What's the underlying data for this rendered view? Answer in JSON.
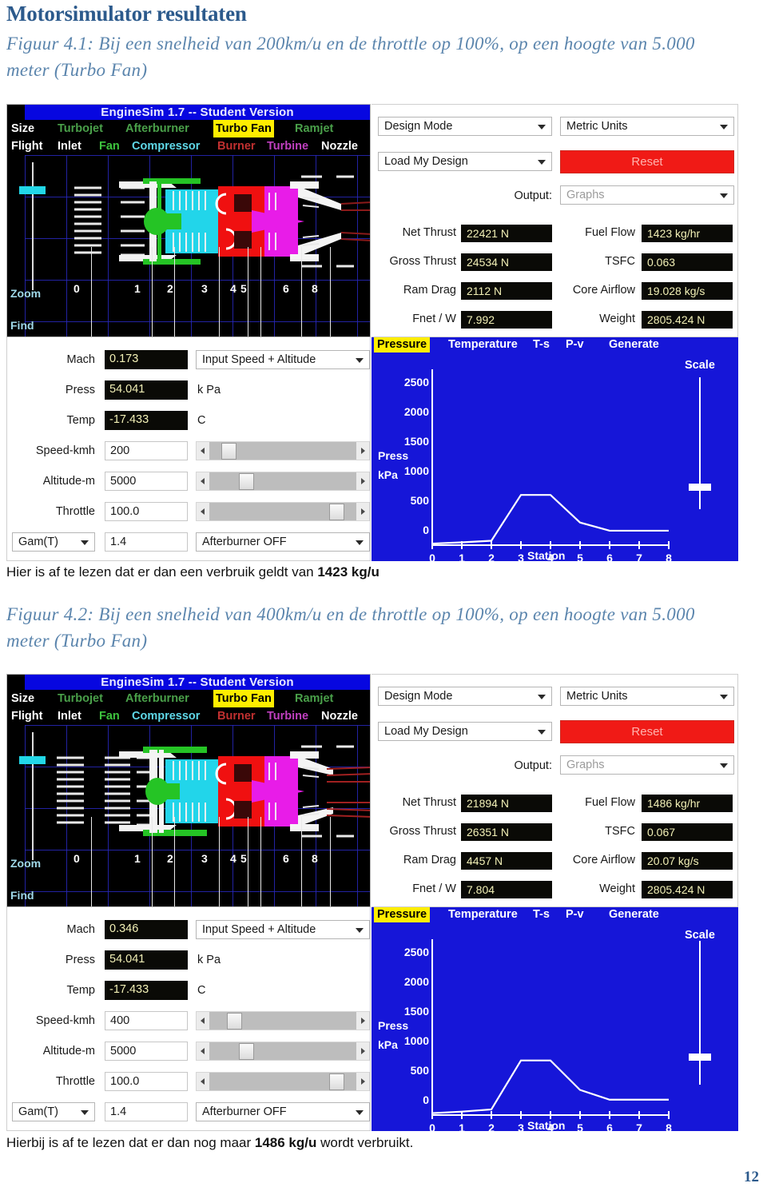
{
  "document": {
    "title": "Motorsimulator resultaten",
    "page_number": "12",
    "figure1_caption": "Figuur 4.1: Bij een snelheid van 200km/u en de throttle op 100%, op een hoogte van 5.000 meter (Turbo Fan)",
    "figure1_note_prefix": "Hier is af te lezen dat er dan een verbruik geldt van ",
    "figure1_note_value": "1423 kg/u",
    "figure1_note_suffix": "",
    "figure2_caption": "Figuur 4.2: Bij een snelheid van 400km/u en de throttle op 100%, op een hoogte van 5.000 meter (Turbo Fan)",
    "figure2_note_prefix": "Hierbij is af te lezen dat er dan nog maar ",
    "figure2_note_value": "1486 kg/u",
    "figure2_note_suffix": " wordt verbruikt."
  },
  "colors": {
    "heading": "#2c5a8c",
    "caption": "#5b85ad",
    "graph_background": "#1616d8",
    "title_bar": "#0707e0",
    "highlight": "#ffee00",
    "reset_button": "#f01a16",
    "readout_text": "#f2f0b6"
  },
  "sim": {
    "title_bar": "EngineSim 1.7  -- Student Version",
    "menu_row1": [
      {
        "label": "Size",
        "color": "#ffffff",
        "selected": false
      },
      {
        "label": "Turbojet",
        "color": "#4aa04a",
        "selected": false
      },
      {
        "label": "Afterburner",
        "color": "#4aa04a",
        "selected": false
      },
      {
        "label": "Turbo Fan",
        "color": "#000000",
        "selected": true
      },
      {
        "label": "Ramjet",
        "color": "#4aa04a",
        "selected": false
      }
    ],
    "menu_row2": [
      {
        "label": "Flight",
        "color": "#ffffff",
        "selected": false
      },
      {
        "label": "Inlet",
        "color": "#ffffff",
        "selected": false
      },
      {
        "label": "Fan",
        "color": "#3ec43e",
        "selected": false
      },
      {
        "label": "Compressor",
        "color": "#5fd8e8",
        "selected": false
      },
      {
        "label": "Burner",
        "color": "#c03030",
        "selected": false
      },
      {
        "label": "Turbine",
        "color": "#c040c0",
        "selected": false
      },
      {
        "label": "Nozzle",
        "color": "#ffffff",
        "selected": false
      }
    ],
    "side_labels": [
      "Zoom",
      "Find"
    ],
    "station_numbers": [
      "0",
      "1",
      "2",
      "3",
      "4",
      "5",
      "6",
      "8"
    ],
    "controls": {
      "design_mode": "Design Mode",
      "units": "Metric Units",
      "load_design": "Load My Design",
      "reset": "Reset",
      "output_label": "Output:",
      "output_value": "Graphs"
    },
    "graph_menu": [
      "Pressure",
      "Temperature",
      "T-s",
      "P-v",
      "Generate"
    ],
    "graph_selected": "Pressure",
    "scale_label": "Scale",
    "input_mode": "Input Speed + Altitude",
    "afterburner": "Afterburner OFF",
    "gam_label": "Gam(T)",
    "gam_value": "1.4",
    "units_kpa": "k Pa",
    "units_c": "C",
    "labels": {
      "mach": "Mach",
      "press": "Press",
      "temp": "Temp",
      "speed": "Speed-kmh",
      "altitude": "Altitude-m",
      "throttle": "Throttle",
      "net_thrust": "Net Thrust",
      "gross_thrust": "Gross Thrust",
      "ram_drag": "Ram Drag",
      "fnet_w": "Fnet / W",
      "fuel_flow": "Fuel Flow",
      "tsfc": "TSFC",
      "core_airflow": "Core Airflow",
      "weight": "Weight"
    }
  },
  "figure1": {
    "outputs": {
      "net_thrust": "22421 N",
      "gross_thrust": "24534 N",
      "ram_drag": "2112 N",
      "fnet_w": "7.992",
      "fuel_flow": "1423 kg/hr",
      "tsfc": "0.063",
      "core_airflow": "19.028 kg/s",
      "weight": "2805.424 N"
    },
    "inputs": {
      "mach": "0.173",
      "press": "54.041",
      "temp": "-17.433",
      "speed": "200",
      "altitude": "5000",
      "throttle": "100.0"
    },
    "slider_positions": {
      "speed": 9,
      "altitude": 22,
      "throttle": 90
    }
  },
  "figure2": {
    "outputs": {
      "net_thrust": "21894 N",
      "gross_thrust": "26351 N",
      "ram_drag": "4457 N",
      "fnet_w": "7.804",
      "fuel_flow": "1486 kg/hr",
      "tsfc": "0.067",
      "core_airflow": "20.07 kg/s",
      "weight": "2805.424 N"
    },
    "inputs": {
      "mach": "0.346",
      "press": "54.041",
      "temp": "-17.433",
      "speed": "400",
      "altitude": "5000",
      "throttle": "100.0"
    },
    "slider_positions": {
      "speed": 13,
      "altitude": 22,
      "throttle": 90
    }
  },
  "chart_data": [
    {
      "type": "line",
      "title": "Pressure",
      "xlabel": "Station",
      "ylabel": "Press kPa",
      "x": [
        0,
        1,
        2,
        3,
        4,
        5,
        6,
        7,
        8
      ],
      "values": [
        25,
        45,
        70,
        800,
        800,
        360,
        230,
        230,
        230
      ],
      "yticks": [
        0,
        500,
        1000,
        1500,
        2000,
        2500
      ],
      "xticks": [
        0,
        1,
        2,
        3,
        4,
        5,
        6,
        7,
        8
      ],
      "ylim": [
        0,
        2700
      ],
      "xlim": [
        0,
        8
      ],
      "grid": false,
      "legend": "none"
    },
    {
      "type": "line",
      "title": "Pressure",
      "xlabel": "Station",
      "ylabel": "Press kPa",
      "x": [
        0,
        1,
        2,
        3,
        4,
        5,
        6,
        7,
        8
      ],
      "values": [
        30,
        55,
        90,
        870,
        870,
        400,
        245,
        245,
        245
      ],
      "yticks": [
        0,
        500,
        1000,
        1500,
        2000,
        2500
      ],
      "xticks": [
        0,
        1,
        2,
        3,
        4,
        5,
        6,
        7,
        8
      ],
      "ylim": [
        0,
        2700
      ],
      "xlim": [
        0,
        8
      ],
      "grid": false,
      "legend": "none"
    }
  ]
}
